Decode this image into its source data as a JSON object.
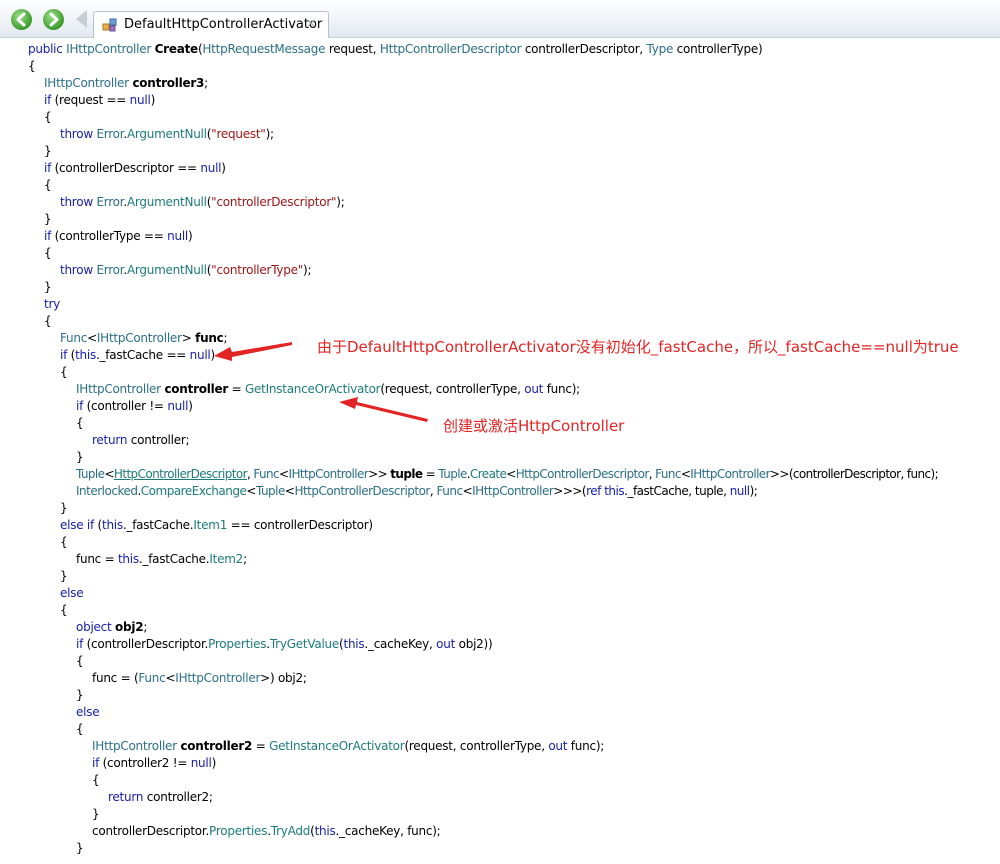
{
  "tab": {
    "title": "DefaultHttpControllerActivator",
    "close": "×"
  },
  "code": {
    "l0": [
      "public ",
      "IHttpController ",
      "Create",
      "(",
      "HttpRequestMessage",
      " request, ",
      "HttpControllerDescriptor",
      " controllerDescriptor, ",
      "Type",
      " controllerType)"
    ],
    "l1": "{",
    "l2": [
      "IHttpController ",
      "controller3",
      ";"
    ],
    "l3": [
      "if",
      " (request == ",
      "null",
      ")"
    ],
    "l4": "{",
    "l5": [
      "throw ",
      "Error",
      ".",
      "ArgumentNull",
      "(",
      "\"request\"",
      ");"
    ],
    "l6": "}",
    "l7": [
      "if",
      " (controllerDescriptor == ",
      "null",
      ")"
    ],
    "l8": "{",
    "l9": [
      "throw ",
      "Error",
      ".",
      "ArgumentNull",
      "(",
      "\"controllerDescriptor\"",
      ");"
    ],
    "l10": "}",
    "l11": [
      "if",
      " (controllerType == ",
      "null",
      ")"
    ],
    "l12": "{",
    "l13": [
      "throw ",
      "Error",
      ".",
      "ArgumentNull",
      "(",
      "\"controllerType\"",
      ");"
    ],
    "l14": "}",
    "l15": "try",
    "l16": "{",
    "l17": [
      "Func",
      "<",
      "IHttpController",
      "> ",
      "func",
      ";"
    ],
    "l18": [
      "if",
      " (",
      "this",
      "._fastCache == ",
      "null",
      ")"
    ],
    "l19": "{",
    "l20": [
      "IHttpController ",
      "controller",
      " = ",
      "GetInstanceOrActivator",
      "(request, controllerType, ",
      "out",
      " func);"
    ],
    "l21": [
      "if",
      " (controller != ",
      "null",
      ")"
    ],
    "l22": "{",
    "l23": [
      "return",
      " controller;"
    ],
    "l24": "}",
    "l25": [
      "Tuple",
      "<",
      "HttpControllerDescriptor",
      ", ",
      "Func",
      "<",
      "IHttpController",
      ">> ",
      "tuple",
      " = ",
      "Tuple",
      ".",
      "Create",
      "<",
      "HttpControllerDescriptor",
      ", ",
      "Func",
      "<",
      "IHttpController",
      ">>(controllerDescriptor, func);"
    ],
    "l26": [
      "Interlocked",
      ".",
      "CompareExchange",
      "<",
      "Tuple",
      "<",
      "HttpControllerDescriptor",
      ", ",
      "Func",
      "<",
      "IHttpController",
      ">>>(",
      "ref ",
      "this",
      "._fastCache, tuple, ",
      "null",
      ");"
    ],
    "l27": "}",
    "l28": [
      "else if",
      " (",
      "this",
      "._fastCache.",
      "Item1",
      " == controllerDescriptor)"
    ],
    "l29": "{",
    "l30": [
      "func = ",
      "this",
      "._fastCache.",
      "Item2",
      ";"
    ],
    "l31": "}",
    "l32": "else",
    "l33": "{",
    "l34": [
      "object ",
      "obj2",
      ";"
    ],
    "l35": [
      "if",
      " (controllerDescriptor.",
      "Properties",
      ".",
      "TryGetValue",
      "(",
      "this",
      "._cacheKey, ",
      "out",
      " obj2))"
    ],
    "l36": "{",
    "l37": [
      "func = (",
      "Func",
      "<",
      "IHttpController",
      ">) obj2;"
    ],
    "l38": "}",
    "l39": "else",
    "l40": "{",
    "l41": [
      "IHttpController ",
      "controller2",
      " = ",
      "GetInstanceOrActivator",
      "(request, controllerType, ",
      "out",
      " func);"
    ],
    "l42": [
      "if",
      " (controller2 != ",
      "null",
      ")"
    ],
    "l43": "{",
    "l44": [
      "return",
      " controller2;"
    ],
    "l45": "}",
    "l46": [
      "controllerDescriptor.",
      "Properties",
      ".",
      "TryAdd",
      "(",
      "this",
      "._cacheKey, func);"
    ],
    "l47": "}"
  },
  "annotations": {
    "fast_cache_note": "由于DefaultHttpControllerActivator没有初始化_fastCache，所以_fastCache==null为true",
    "create_note": "创建或激活HttpController"
  },
  "colors": {
    "annotation": "#e32424",
    "keyword": "#1a21a8",
    "type": "#2b6f86",
    "string": "#9b1414"
  }
}
